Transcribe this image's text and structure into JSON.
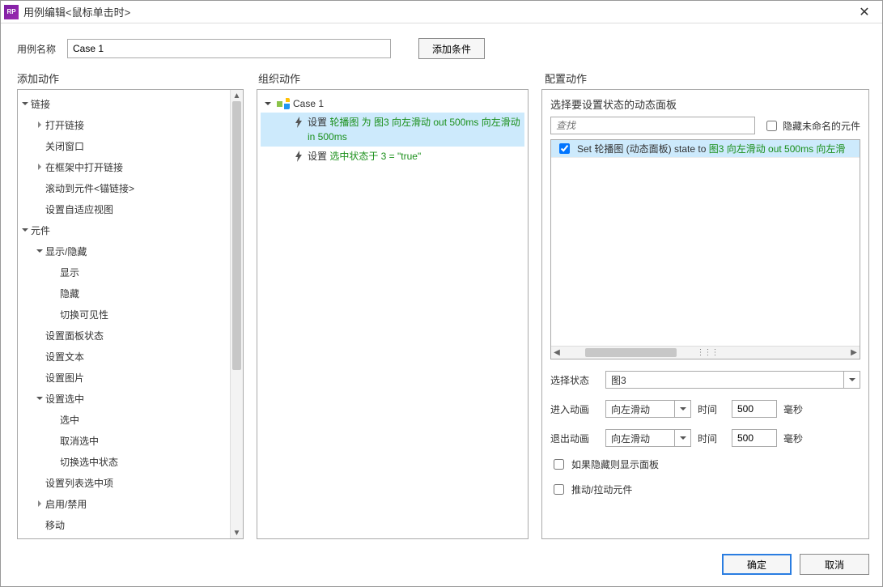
{
  "window": {
    "app_badge": "RP",
    "title": "用例编辑<鼠标单击时>"
  },
  "toprow": {
    "label": "用例名称",
    "value": "Case 1",
    "add_cond": "添加条件"
  },
  "headers": {
    "h1": "添加动作",
    "h2": "组织动作",
    "h3": "配置动作"
  },
  "tree": [
    {
      "lvl": 0,
      "arrow": "down",
      "label": "链接"
    },
    {
      "lvl": 1,
      "arrow": "right",
      "label": "打开链接"
    },
    {
      "lvl": 1,
      "arrow": "none",
      "label": "关闭窗口"
    },
    {
      "lvl": 1,
      "arrow": "right",
      "label": "在框架中打开链接"
    },
    {
      "lvl": 1,
      "arrow": "none",
      "label": "滚动到元件<锚链接>"
    },
    {
      "lvl": 1,
      "arrow": "none",
      "label": "设置自适应视图"
    },
    {
      "lvl": 0,
      "arrow": "down",
      "label": "元件"
    },
    {
      "lvl": 1,
      "arrow": "down",
      "label": "显示/隐藏"
    },
    {
      "lvl": 2,
      "arrow": "none",
      "label": "显示"
    },
    {
      "lvl": 2,
      "arrow": "none",
      "label": "隐藏"
    },
    {
      "lvl": 2,
      "arrow": "none",
      "label": "切换可见性"
    },
    {
      "lvl": 1,
      "arrow": "none",
      "label": "设置面板状态"
    },
    {
      "lvl": 1,
      "arrow": "none",
      "label": "设置文本"
    },
    {
      "lvl": 1,
      "arrow": "none",
      "label": "设置图片"
    },
    {
      "lvl": 1,
      "arrow": "down",
      "label": "设置选中"
    },
    {
      "lvl": 2,
      "arrow": "none",
      "label": "选中"
    },
    {
      "lvl": 2,
      "arrow": "none",
      "label": "取消选中"
    },
    {
      "lvl": 2,
      "arrow": "none",
      "label": "切换选中状态"
    },
    {
      "lvl": 1,
      "arrow": "none",
      "label": "设置列表选中项"
    },
    {
      "lvl": 1,
      "arrow": "right",
      "label": "启用/禁用"
    },
    {
      "lvl": 1,
      "arrow": "none",
      "label": "移动"
    }
  ],
  "case": {
    "name": "Case 1",
    "actions": [
      {
        "selected": true,
        "prefix": "设置 ",
        "green": "轮播图 为 图3 向左滑动 out 500ms 向左滑动 in 500ms"
      },
      {
        "selected": false,
        "prefix": "设置 ",
        "green": "选中状态于 3 = \"true\""
      }
    ]
  },
  "configure": {
    "section_title": "选择要设置状态的动态面板",
    "search_placeholder": "查找",
    "hide_unnamed": "隐藏未命名的元件",
    "list_item_prefix": "Set 轮播图 (动态面板) state to ",
    "list_item_green": "图3 向左滑动 out 500ms 向左滑",
    "select_state_label": "选择状态",
    "select_state_value": "图3",
    "anim_in_label": "进入动画",
    "anim_out_label": "退出动画",
    "anim_in_value": "向左滑动",
    "anim_out_value": "向左滑动",
    "time_label": "时间",
    "time_in_value": "500",
    "time_out_value": "500",
    "ms_label": "毫秒",
    "chk_show_if_hidden": "如果隐藏则显示面板",
    "chk_push_pull": "推动/拉动元件"
  },
  "buttons": {
    "ok": "确定",
    "cancel": "取消"
  }
}
